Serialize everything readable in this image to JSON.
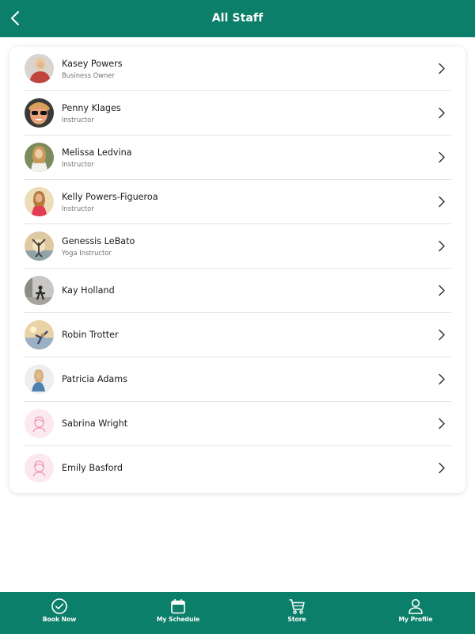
{
  "header": {
    "title": "All Staff",
    "back_icon": "chevron-left-icon"
  },
  "staff": [
    {
      "name": "Kasey Powers",
      "role": "Business Owner",
      "avatar": "photo"
    },
    {
      "name": "Penny Klages",
      "role": "Instructor",
      "avatar": "photo"
    },
    {
      "name": "Melissa Ledvina",
      "role": "Instructor",
      "avatar": "photo"
    },
    {
      "name": "Kelly Powers-Figueroa",
      "role": "Instructor",
      "avatar": "photo"
    },
    {
      "name": "Genessis LeBato",
      "role": "Yoga Instructor",
      "avatar": "photo"
    },
    {
      "name": "Kay Holland",
      "role": "",
      "avatar": "photo"
    },
    {
      "name": "Robin Trotter",
      "role": "",
      "avatar": "photo"
    },
    {
      "name": "Patricia Adams",
      "role": "",
      "avatar": "photo"
    },
    {
      "name": "Sabrina Wright",
      "role": "",
      "avatar": "placeholder-person-icon"
    },
    {
      "name": "Emily Basford",
      "role": "",
      "avatar": "placeholder-person-icon"
    }
  ],
  "nav": {
    "tabs": [
      {
        "label": "Book Now",
        "icon": "check-circle-icon"
      },
      {
        "label": "My Schedule",
        "icon": "calendar-icon"
      },
      {
        "label": "Store",
        "icon": "cart-icon"
      },
      {
        "label": "My Profile",
        "icon": "person-icon"
      }
    ]
  },
  "colors": {
    "brand": "#0b7f69",
    "placeholder_bg": "#fce8ef",
    "placeholder_stroke": "#e88aa5"
  }
}
